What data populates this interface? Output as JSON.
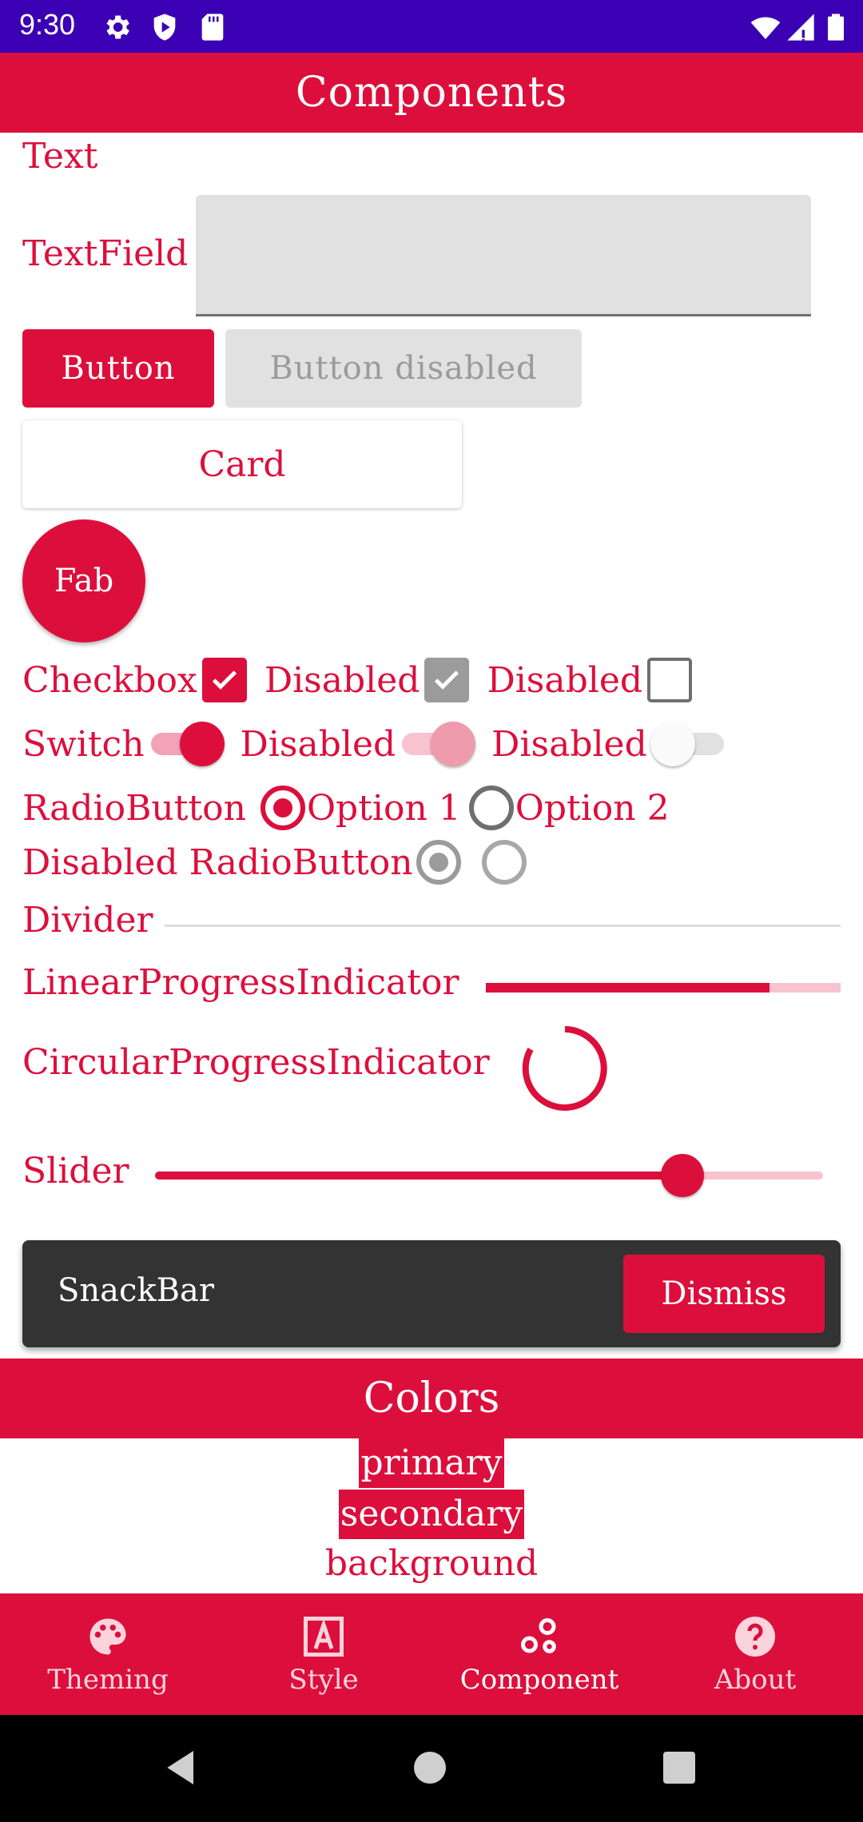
{
  "status_bar": {
    "time": "9:30"
  },
  "header": {
    "title": "Components"
  },
  "components": {
    "text_label": "Text",
    "textfield_label": "TextField",
    "textfield_value": "",
    "button_label": "Button",
    "button_disabled_label": "Button disabled",
    "card_label": "Card",
    "fab_label": "Fab",
    "checkbox_label": "Checkbox",
    "checkbox_disabled_label_1": "Disabled",
    "checkbox_disabled_label_2": "Disabled",
    "switch_label": "Switch",
    "switch_disabled_label_1": "Disabled",
    "switch_disabled_label_2": "Disabled",
    "radio_label": "RadioButton",
    "radio_option_1": "Option 1",
    "radio_option_2": "Option 2",
    "disabled_radio_label": "Disabled RadioButton",
    "divider_label": "Divider",
    "linear_progress_label": "LinearProgressIndicator",
    "linear_progress_value": 0.8,
    "circular_progress_label": "CircularProgressIndicator",
    "slider_label": "Slider",
    "slider_value": 0.79,
    "snackbar_text": "SnackBar",
    "snackbar_action": "Dismiss"
  },
  "colors_section": {
    "title": "Colors",
    "primary": "primary",
    "secondary": "secondary",
    "background": "background",
    "accent_color": "#dc0f3c"
  },
  "bottom_nav": {
    "items": [
      {
        "label": "Theming",
        "icon": "palette-icon"
      },
      {
        "label": "Style",
        "icon": "text-style-icon"
      },
      {
        "label": "Component",
        "icon": "component-icon",
        "active": true
      },
      {
        "label": "About",
        "icon": "help-icon"
      }
    ]
  }
}
